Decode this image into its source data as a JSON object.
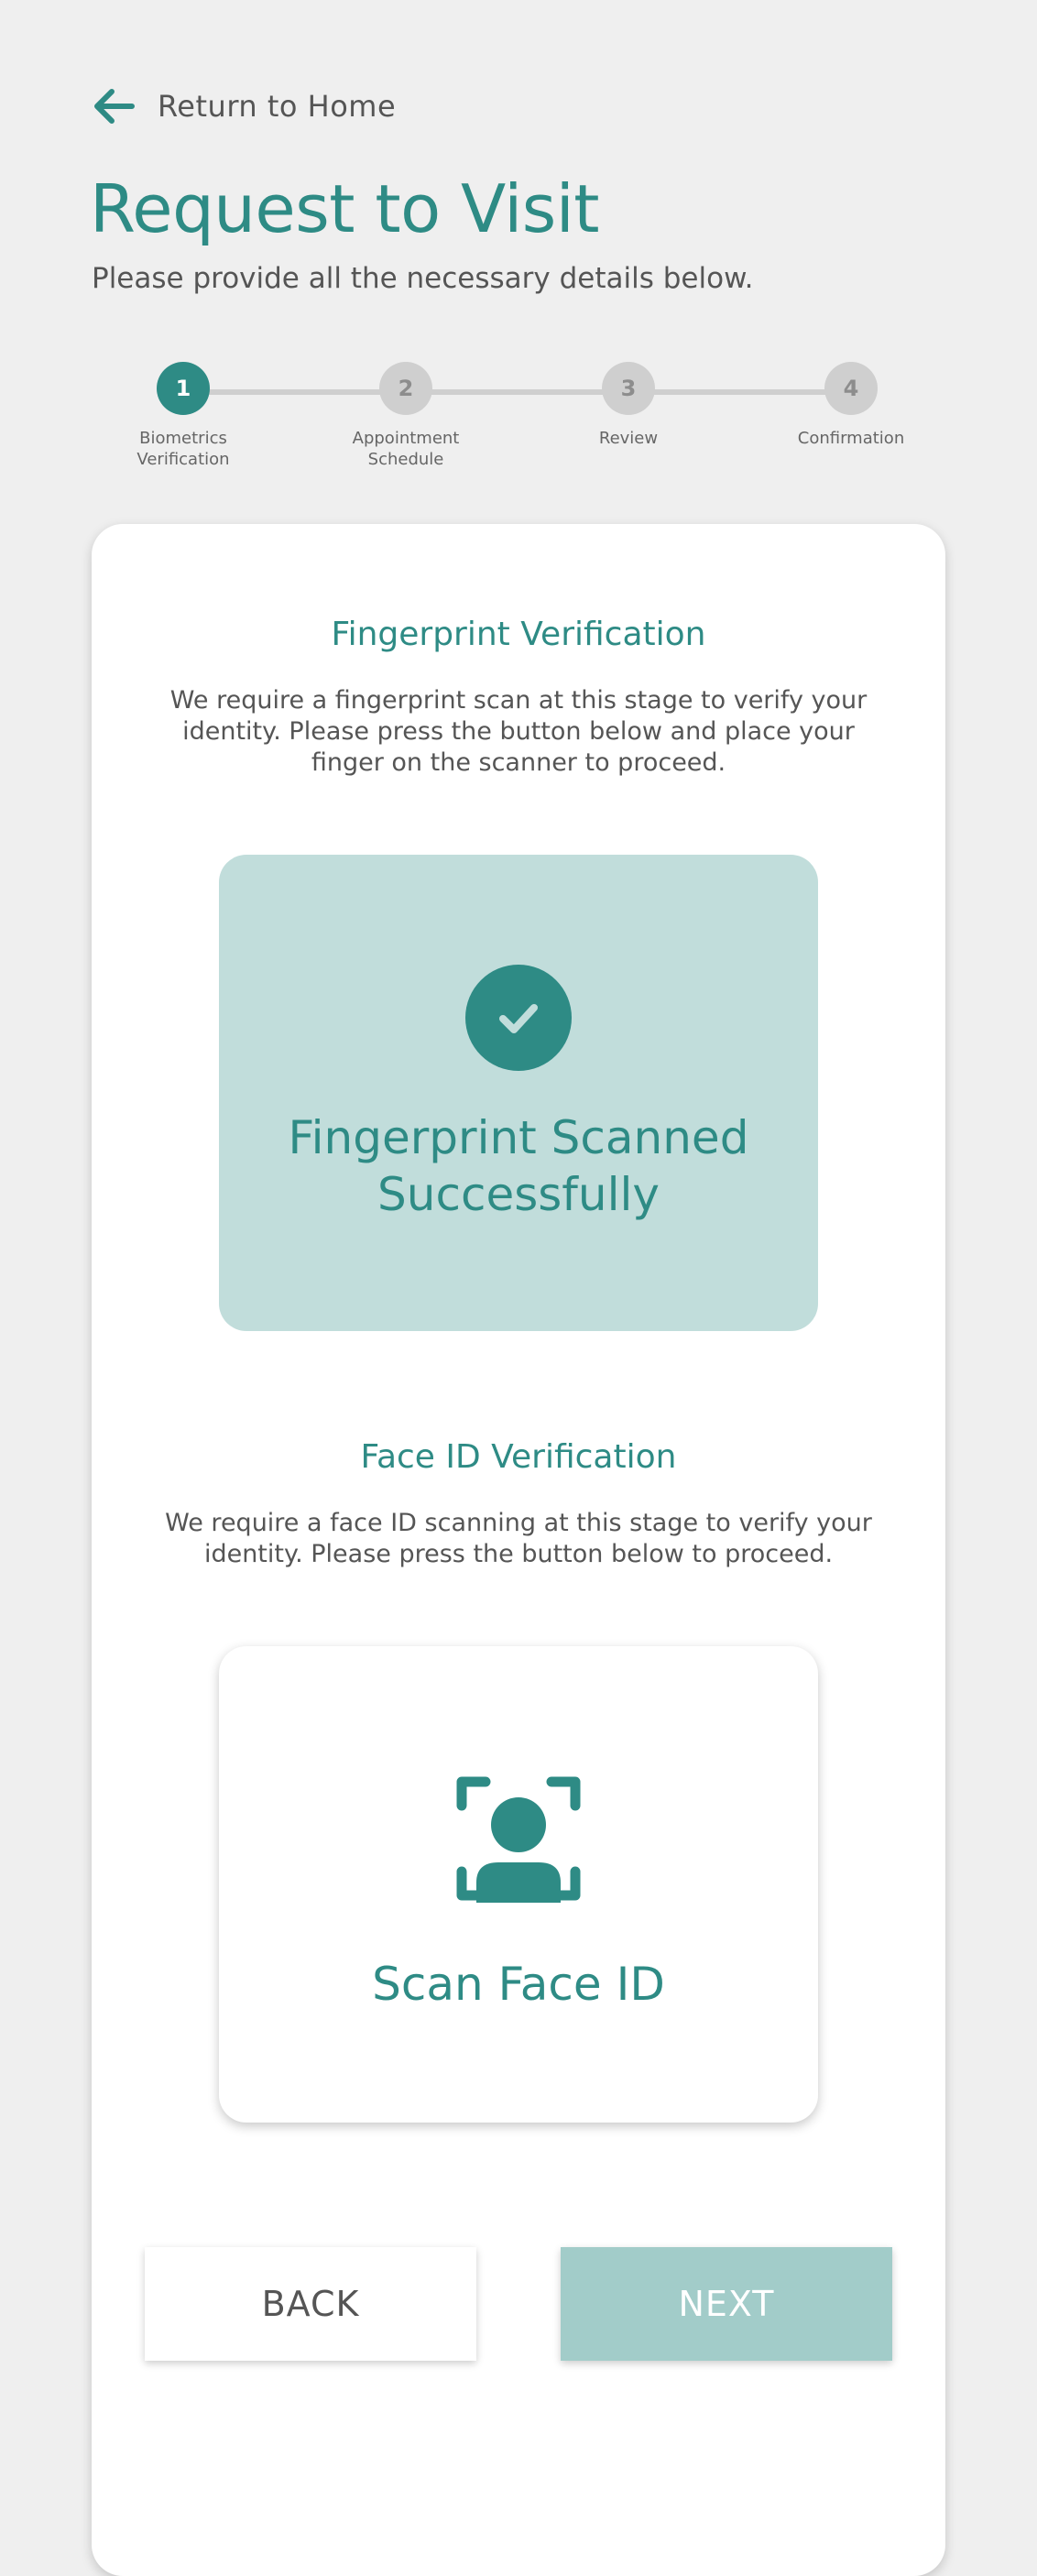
{
  "header": {
    "back_label": "Return to Home",
    "title": "Request to Visit",
    "subtitle": "Please provide all the necessary details below."
  },
  "stepper": {
    "steps": [
      {
        "number": "1",
        "label": "Biometrics Verification",
        "state": "active"
      },
      {
        "number": "2",
        "label": "Appointment Schedule",
        "state": "inactive"
      },
      {
        "number": "3",
        "label": "Review",
        "state": "inactive"
      },
      {
        "number": "4",
        "label": "Confirmation",
        "state": "inactive"
      }
    ]
  },
  "fingerprint": {
    "title": "Fingerprint Verification",
    "description": "We require a fingerprint scan at this stage to verify your identity. Please press the button below and place your finger on the scanner to proceed.",
    "status_text": "Fingerprint Scanned Successfully",
    "status_icon": "check-circle-icon"
  },
  "face_id": {
    "title": "Face ID Verification",
    "description": "We require a face ID scanning at this stage to verify your identity. Please press the button below to proceed.",
    "button_label": "Scan Face ID",
    "icon": "face-scan-icon"
  },
  "actions": {
    "back_label": "BACK",
    "next_label": "NEXT"
  },
  "colors": {
    "accent": "#2e8b85",
    "success_bg": "#c1dddb",
    "next_disabled": "#a2ccc9",
    "background": "#efefef"
  }
}
